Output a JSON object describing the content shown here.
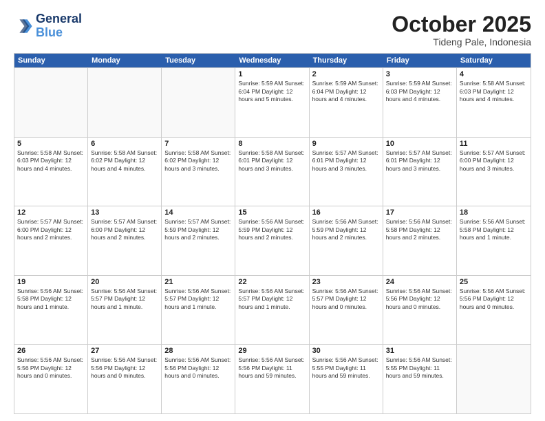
{
  "logo": {
    "line1": "General",
    "line2": "Blue"
  },
  "title": "October 2025",
  "subtitle": "Tideng Pale, Indonesia",
  "header": {
    "days": [
      "Sunday",
      "Monday",
      "Tuesday",
      "Wednesday",
      "Thursday",
      "Friday",
      "Saturday"
    ]
  },
  "weeks": [
    [
      {
        "day": "",
        "info": ""
      },
      {
        "day": "",
        "info": ""
      },
      {
        "day": "",
        "info": ""
      },
      {
        "day": "1",
        "info": "Sunrise: 5:59 AM\nSunset: 6:04 PM\nDaylight: 12 hours\nand 5 minutes."
      },
      {
        "day": "2",
        "info": "Sunrise: 5:59 AM\nSunset: 6:04 PM\nDaylight: 12 hours\nand 4 minutes."
      },
      {
        "day": "3",
        "info": "Sunrise: 5:59 AM\nSunset: 6:03 PM\nDaylight: 12 hours\nand 4 minutes."
      },
      {
        "day": "4",
        "info": "Sunrise: 5:58 AM\nSunset: 6:03 PM\nDaylight: 12 hours\nand 4 minutes."
      }
    ],
    [
      {
        "day": "5",
        "info": "Sunrise: 5:58 AM\nSunset: 6:03 PM\nDaylight: 12 hours\nand 4 minutes."
      },
      {
        "day": "6",
        "info": "Sunrise: 5:58 AM\nSunset: 6:02 PM\nDaylight: 12 hours\nand 4 minutes."
      },
      {
        "day": "7",
        "info": "Sunrise: 5:58 AM\nSunset: 6:02 PM\nDaylight: 12 hours\nand 3 minutes."
      },
      {
        "day": "8",
        "info": "Sunrise: 5:58 AM\nSunset: 6:01 PM\nDaylight: 12 hours\nand 3 minutes."
      },
      {
        "day": "9",
        "info": "Sunrise: 5:57 AM\nSunset: 6:01 PM\nDaylight: 12 hours\nand 3 minutes."
      },
      {
        "day": "10",
        "info": "Sunrise: 5:57 AM\nSunset: 6:01 PM\nDaylight: 12 hours\nand 3 minutes."
      },
      {
        "day": "11",
        "info": "Sunrise: 5:57 AM\nSunset: 6:00 PM\nDaylight: 12 hours\nand 3 minutes."
      }
    ],
    [
      {
        "day": "12",
        "info": "Sunrise: 5:57 AM\nSunset: 6:00 PM\nDaylight: 12 hours\nand 2 minutes."
      },
      {
        "day": "13",
        "info": "Sunrise: 5:57 AM\nSunset: 6:00 PM\nDaylight: 12 hours\nand 2 minutes."
      },
      {
        "day": "14",
        "info": "Sunrise: 5:57 AM\nSunset: 5:59 PM\nDaylight: 12 hours\nand 2 minutes."
      },
      {
        "day": "15",
        "info": "Sunrise: 5:56 AM\nSunset: 5:59 PM\nDaylight: 12 hours\nand 2 minutes."
      },
      {
        "day": "16",
        "info": "Sunrise: 5:56 AM\nSunset: 5:59 PM\nDaylight: 12 hours\nand 2 minutes."
      },
      {
        "day": "17",
        "info": "Sunrise: 5:56 AM\nSunset: 5:58 PM\nDaylight: 12 hours\nand 2 minutes."
      },
      {
        "day": "18",
        "info": "Sunrise: 5:56 AM\nSunset: 5:58 PM\nDaylight: 12 hours\nand 1 minute."
      }
    ],
    [
      {
        "day": "19",
        "info": "Sunrise: 5:56 AM\nSunset: 5:58 PM\nDaylight: 12 hours\nand 1 minute."
      },
      {
        "day": "20",
        "info": "Sunrise: 5:56 AM\nSunset: 5:57 PM\nDaylight: 12 hours\nand 1 minute."
      },
      {
        "day": "21",
        "info": "Sunrise: 5:56 AM\nSunset: 5:57 PM\nDaylight: 12 hours\nand 1 minute."
      },
      {
        "day": "22",
        "info": "Sunrise: 5:56 AM\nSunset: 5:57 PM\nDaylight: 12 hours\nand 1 minute."
      },
      {
        "day": "23",
        "info": "Sunrise: 5:56 AM\nSunset: 5:57 PM\nDaylight: 12 hours\nand 0 minutes."
      },
      {
        "day": "24",
        "info": "Sunrise: 5:56 AM\nSunset: 5:56 PM\nDaylight: 12 hours\nand 0 minutes."
      },
      {
        "day": "25",
        "info": "Sunrise: 5:56 AM\nSunset: 5:56 PM\nDaylight: 12 hours\nand 0 minutes."
      }
    ],
    [
      {
        "day": "26",
        "info": "Sunrise: 5:56 AM\nSunset: 5:56 PM\nDaylight: 12 hours\nand 0 minutes."
      },
      {
        "day": "27",
        "info": "Sunrise: 5:56 AM\nSunset: 5:56 PM\nDaylight: 12 hours\nand 0 minutes."
      },
      {
        "day": "28",
        "info": "Sunrise: 5:56 AM\nSunset: 5:56 PM\nDaylight: 12 hours\nand 0 minutes."
      },
      {
        "day": "29",
        "info": "Sunrise: 5:56 AM\nSunset: 5:56 PM\nDaylight: 11 hours\nand 59 minutes."
      },
      {
        "day": "30",
        "info": "Sunrise: 5:56 AM\nSunset: 5:55 PM\nDaylight: 11 hours\nand 59 minutes."
      },
      {
        "day": "31",
        "info": "Sunrise: 5:56 AM\nSunset: 5:55 PM\nDaylight: 11 hours\nand 59 minutes."
      },
      {
        "day": "",
        "info": ""
      }
    ]
  ]
}
